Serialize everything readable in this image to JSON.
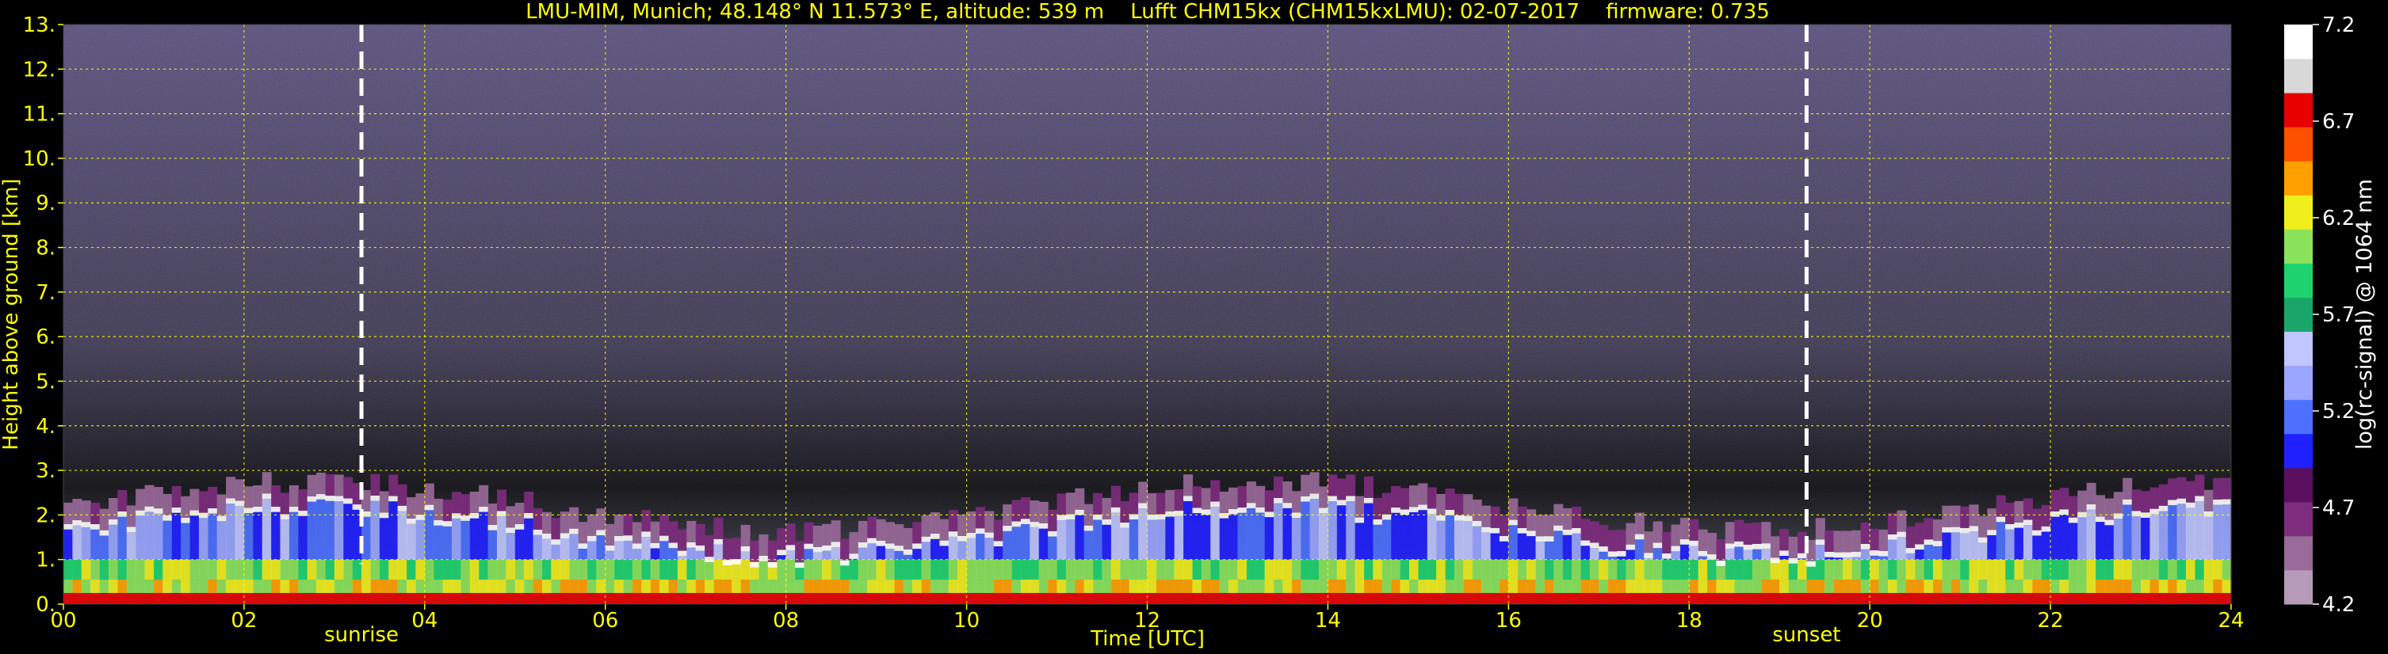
{
  "chart_data": {
    "type": "heatmap",
    "title": "LMU-MIM, Munich; 48.148° N 11.573° E, altitude: 539 m    Lufft CHM15kx (CHM15kxLMU): 02-07-2017    firmware: 0.735",
    "xlabel": "Time [UTC]",
    "ylabel": "Height above ground [km]",
    "colorbar_label": "log(rc-signal) @ 1064 nm",
    "xlim": [
      0,
      24
    ],
    "ylim": [
      0,
      13
    ],
    "clim": [
      4.2,
      7.2
    ],
    "x_ticks": [
      "00",
      "02",
      "04",
      "06",
      "08",
      "10",
      "12",
      "14",
      "16",
      "18",
      "20",
      "22",
      "24"
    ],
    "y_ticks": [
      "0.",
      "1.",
      "2.",
      "3.",
      "4.",
      "5.",
      "6.",
      "7.",
      "8.",
      "9.",
      "10.",
      "11.",
      "12.",
      "13."
    ],
    "colorbar_ticks": [
      "4.2",
      "4.7",
      "5.2",
      "5.7",
      "6.2",
      "6.7",
      "7.2"
    ],
    "grid": true,
    "annotations": [
      {
        "text": "sunrise",
        "x": 3.3
      },
      {
        "text": "sunset",
        "x": 19.3
      }
    ],
    "colors": {
      "text": "#ffff00",
      "grid": "#ffff00",
      "background": "#000000",
      "marker": "#ffffff",
      "colorbar_text": "#ffffff"
    },
    "colormap": [
      "#b59bb8",
      "#9a6a9a",
      "#7e2c7e",
      "#5a0f5f",
      "#2020ff",
      "#4d70ff",
      "#9aa6ff",
      "#c0c6ff",
      "#1aa66a",
      "#1ed36e",
      "#8ae35a",
      "#f0ee1c",
      "#ffa000",
      "#ff5000",
      "#e60000",
      "#d8d8d8",
      "#ffffff"
    ]
  }
}
